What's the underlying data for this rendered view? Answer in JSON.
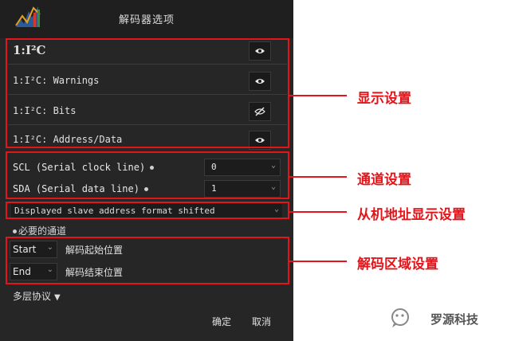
{
  "dialog": {
    "title": "解码器选项",
    "display_items": [
      {
        "label": "1:I²C",
        "eye": "eye-icon"
      },
      {
        "label": "1:I²C: Warnings",
        "eye": "eye-icon"
      },
      {
        "label": "1:I²C: Bits",
        "eye": "eye-off-icon"
      },
      {
        "label": "1:I²C: Address/Data",
        "eye": "eye-icon"
      }
    ],
    "channels": [
      {
        "label": "SCL (Serial clock line)",
        "value": "0"
      },
      {
        "label": "SDA (Serial data line)",
        "value": "1"
      }
    ],
    "address_format": "Displayed slave address format shifted",
    "required_note": "必要的通道",
    "range": [
      {
        "value": "Start",
        "label": "解码起始位置"
      },
      {
        "value": "End",
        "label": "解码结束位置"
      }
    ],
    "protocol_menu": "多层协议",
    "ok_label": "确定",
    "cancel_label": "取消"
  },
  "annotations": {
    "display": "显示设置",
    "channel": "通道设置",
    "slave": "从机地址显示设置",
    "range": "解码区域设置"
  },
  "watermark": {
    "text": "罗源科技"
  },
  "colors": {
    "highlight": "#e3151a",
    "dialog_bg": "#262626"
  }
}
